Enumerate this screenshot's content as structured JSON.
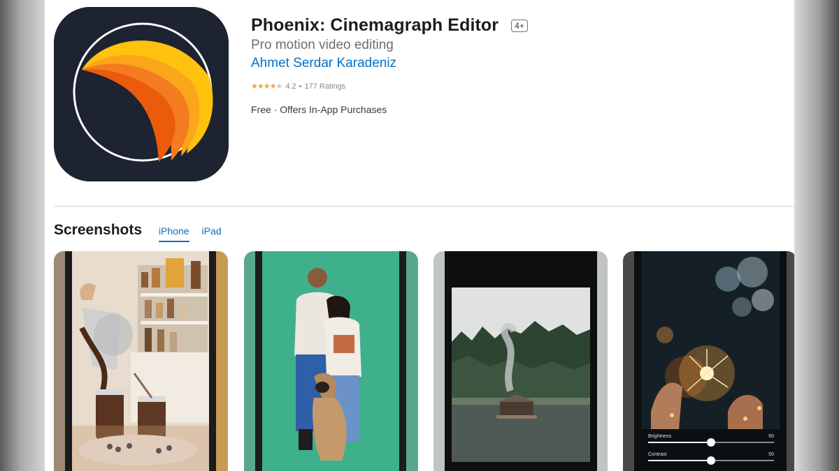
{
  "app": {
    "title": "Phoenix: Cinemagraph Editor",
    "age_rating": "4+",
    "subtitle": "Pro motion video editing",
    "developer": "Ahmet Serdar Karadeniz",
    "rating": {
      "stars": 4.2,
      "value": "4.2",
      "separator": "•",
      "count": "177 Ratings"
    },
    "price": "Free · Offers In-App Purchases",
    "icon": "phoenix-app-icon"
  },
  "screenshots": {
    "title": "Screenshots",
    "tabs": [
      {
        "label": "iPhone",
        "active": true
      },
      {
        "label": "iPad",
        "active": false
      }
    ],
    "items": [
      {
        "image": "pouring-chocolate-photo"
      },
      {
        "image": "couple-with-dog-photo"
      },
      {
        "image": "lake-cabin-smoke-photo"
      },
      {
        "image": "sparkler-photo",
        "sliders": [
          {
            "label": "Brightness",
            "value": "50",
            "level": 0.5
          },
          {
            "label": "Contrast",
            "value": "50",
            "level": 0.5
          }
        ]
      }
    ]
  },
  "colors": {
    "link": "#0070c9",
    "star": "#f5a623",
    "icon_bg": "#1d2330"
  }
}
